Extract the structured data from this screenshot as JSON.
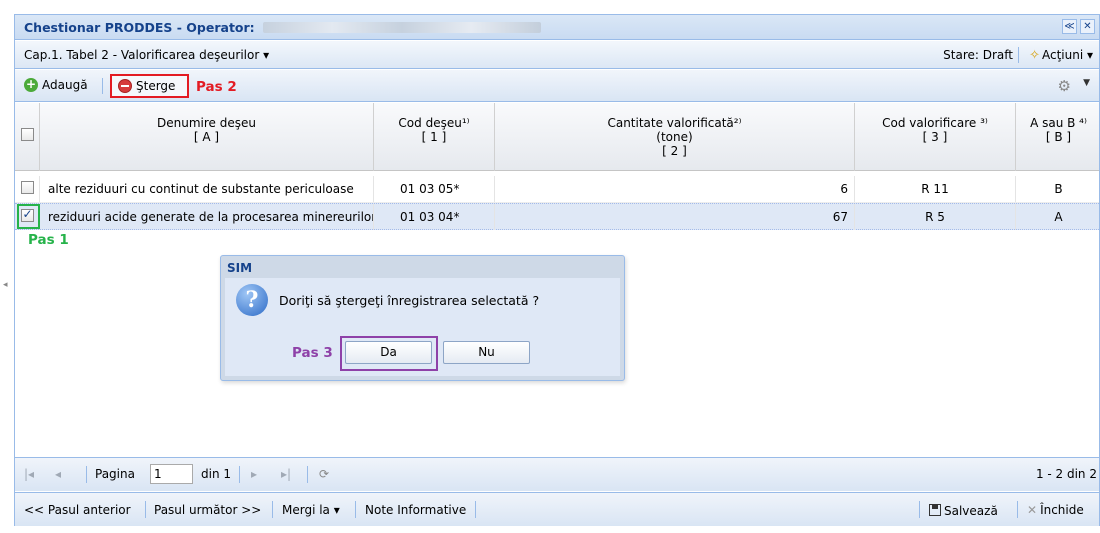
{
  "window": {
    "title": "Chestionar PRODDES - Operator:",
    "collapse_glyph": "≪",
    "close_glyph": "✕"
  },
  "chapter_bar": {
    "chapter": "Cap.1. Tabel 2 - Valorificarea deşeurilor ▾",
    "state": "Stare: Draft",
    "actions": "Acţiuni ▾"
  },
  "toolbar": {
    "add_label": "Adaugă",
    "delete_label": "Şterge",
    "step2_annotation": "Pas 2"
  },
  "grid": {
    "columns": [
      {
        "line1": "Denumire deşeu",
        "line2": "[ A ]",
        "line3": ""
      },
      {
        "line1": "Cod deşeu¹⁾",
        "line2": "[ 1 ]",
        "line3": ""
      },
      {
        "line1": "Cantitate valorificată²⁾",
        "line2": "(tone)",
        "line3": "[ 2 ]"
      },
      {
        "line1": "Cod valorificare ³⁾",
        "line2": "[ 3 ]",
        "line3": ""
      },
      {
        "line1": "A sau B ⁴⁾",
        "line2": "[ B ]",
        "line3": ""
      }
    ],
    "rows": [
      {
        "denumire": "alte reziduuri cu continut de substante periculoase",
        "cod": "01 03 05*",
        "cantitate": "6",
        "cod_valorificare": "R 11",
        "a_sau_b": "B",
        "selected": false
      },
      {
        "denumire": "reziduuri acide generate de la procesarea minereurilor",
        "cod": "01 03 04*",
        "cantitate": "67",
        "cod_valorificare": "R 5",
        "a_sau_b": "A",
        "selected": true
      }
    ],
    "step1_annotation": "Pas 1"
  },
  "dialog": {
    "title": "SIM",
    "message": "Doriţi să ştergeţi înregistrarea selectată ?",
    "yes_label": "Da",
    "no_label": "Nu",
    "step3_annotation": "Pas 3"
  },
  "pager": {
    "page_label": "Pagina",
    "page_value": "1",
    "of_label": "din 1",
    "summary": "1 - 2 din 2"
  },
  "footer": {
    "prev": "<< Pasul anterior",
    "next": "Pasul următor >>",
    "goto": "Mergi la ▾",
    "notes": "Note Informative",
    "save": "Salvează",
    "close": "Închide"
  },
  "colors": {
    "step1": "#26b34a",
    "step2": "#e31b23",
    "step3": "#8e41a8",
    "header_text": "#15428b"
  }
}
